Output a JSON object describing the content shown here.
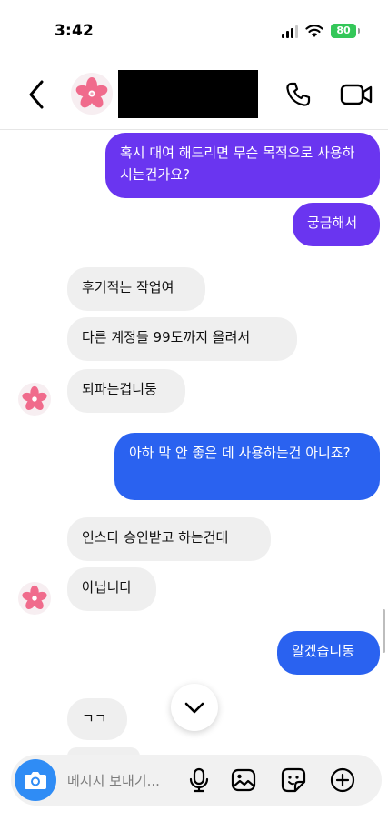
{
  "status_bar": {
    "time": "3:42",
    "battery": "80"
  },
  "header": {},
  "messages": [
    {
      "side": "out",
      "text": "혹시 대여 해드리면 무슨 목적으로 사용하시는건가요?",
      "color": "#6a35f0"
    },
    {
      "side": "out",
      "text": "궁금해서",
      "color": "#6a35f0"
    },
    {
      "side": "in",
      "text": "후기적는 작업여"
    },
    {
      "side": "in",
      "text": "다른 계정들 99도까지 올려서"
    },
    {
      "side": "in",
      "text": "되파는겁니둥"
    },
    {
      "side": "out",
      "text": "아하 막 안 좋은 데 사용하는건 아니죠?",
      "color": "#2a62f0"
    },
    {
      "side": "in",
      "text": "인스타 승인받고 하는건데"
    },
    {
      "side": "in",
      "text": "아닙니다"
    },
    {
      "side": "out",
      "text": "알겠습니동",
      "color": "#2a62f0"
    },
    {
      "side": "in",
      "text": "ㄱㄱ"
    }
  ],
  "composer": {
    "placeholder": "메시지 보내기..."
  },
  "icons": [
    "back-chevron-icon",
    "phone-icon",
    "video-icon",
    "chevron-down-icon",
    "camera-icon",
    "microphone-icon",
    "gallery-icon",
    "sticker-icon",
    "plus-icon"
  ]
}
